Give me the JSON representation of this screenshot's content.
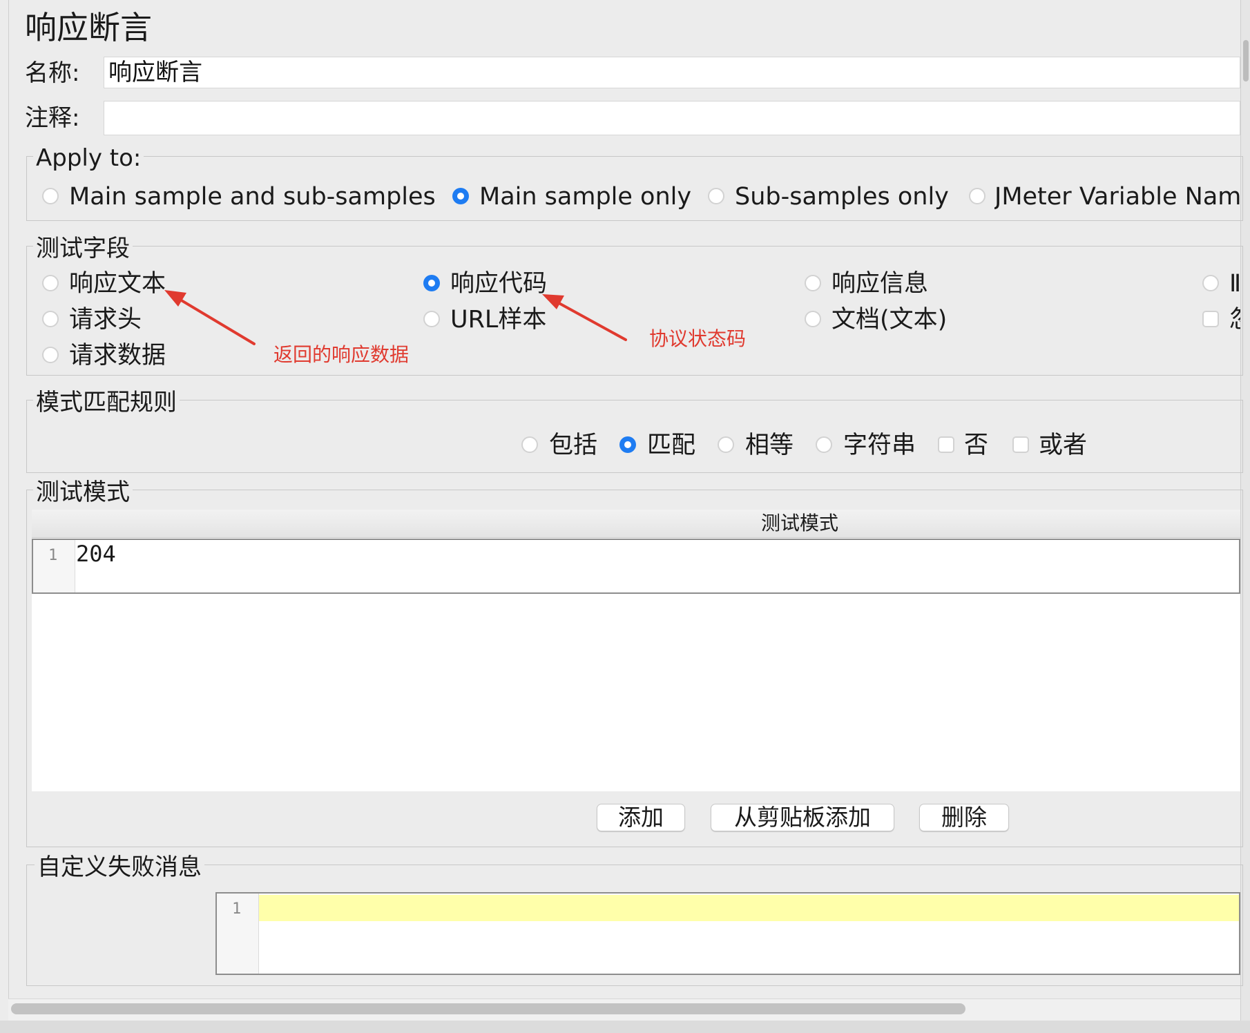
{
  "title": "响应断言",
  "name_label": "名称:",
  "name_value": "响应断言",
  "comment_label": "注释:",
  "comment_value": "",
  "apply_to": {
    "legend": "Apply to:",
    "options": [
      "Main sample and sub-samples",
      "Main sample only",
      "Sub-samples only",
      "JMeter Variable Name"
    ],
    "selected": "Main sample only"
  },
  "test_field": {
    "legend": "测试字段",
    "options": [
      "响应文本",
      "响应代码",
      "响应信息",
      "请求头",
      "URL样本",
      "文档(文本)",
      "请求数据"
    ],
    "selected": "响应代码",
    "cut_radio_glyph": "Ⅱ",
    "cut_check_glyph": "忽"
  },
  "annotations": {
    "response_text": "返回的响应数据",
    "response_code": "协议状态码"
  },
  "pattern_rules": {
    "legend": "模式匹配规则",
    "radios": [
      "包括",
      "匹配",
      "相等",
      "字符串"
    ],
    "selected": "匹配",
    "checks": [
      "否",
      "或者"
    ]
  },
  "test_patterns": {
    "legend": "测试模式",
    "column_header": "测试模式",
    "rows": [
      {
        "line": "1",
        "value": "204"
      }
    ],
    "buttons": {
      "add": "添加",
      "add_clipboard": "从剪贴板添加",
      "delete": "删除"
    }
  },
  "custom_failure": {
    "legend": "自定义失败消息",
    "line": "1",
    "value": ""
  },
  "colors": {
    "accent": "#1e7cf2",
    "annotation": "#e03a2f",
    "highlight_line": "#ffffaa"
  }
}
